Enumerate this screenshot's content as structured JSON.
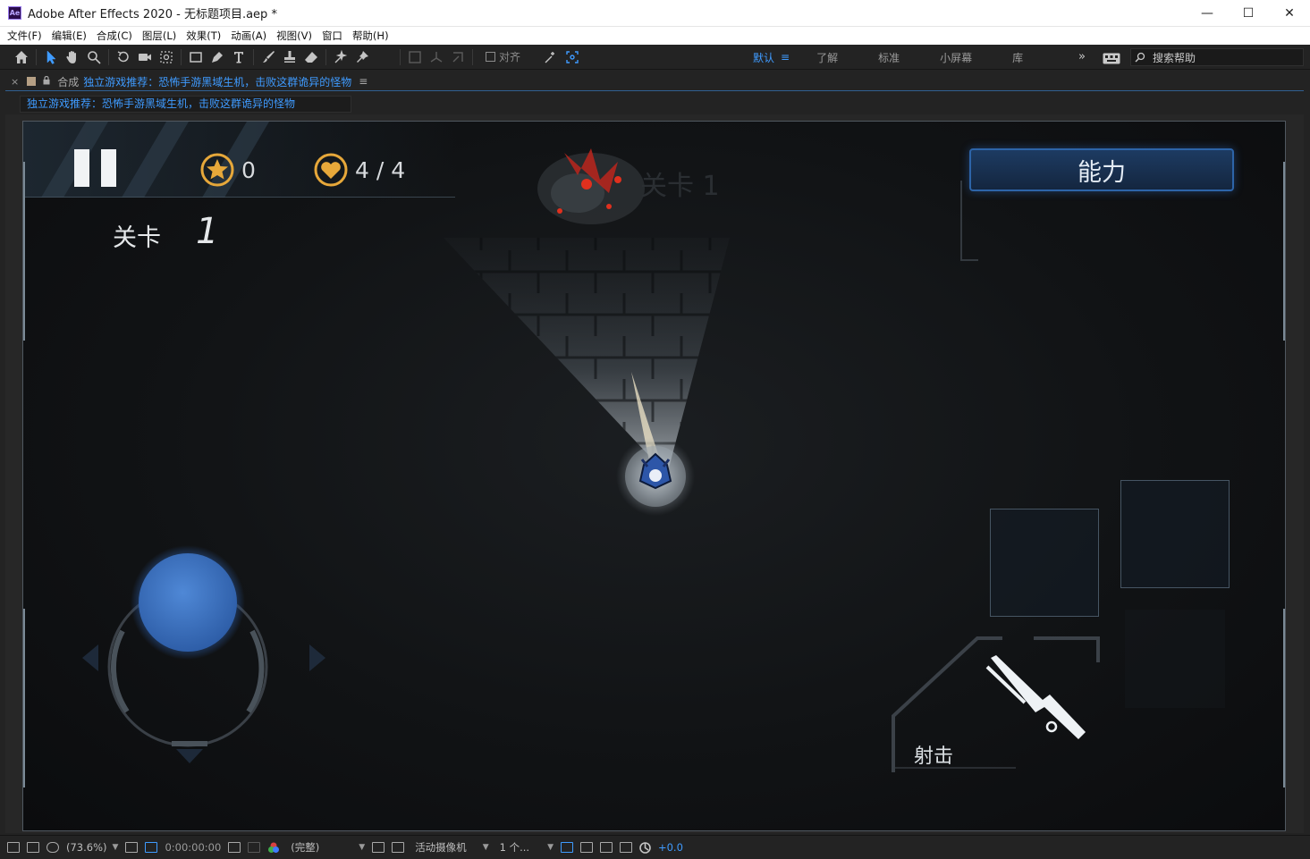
{
  "window": {
    "title": "Adobe After Effects 2020 - 无标题项目.aep *",
    "app_icon_label": "Ae",
    "minimize": "—",
    "maximize": "☐",
    "close": "✕"
  },
  "menu": [
    "文件(F)",
    "编辑(E)",
    "合成(C)",
    "图层(L)",
    "效果(T)",
    "动画(A)",
    "视图(V)",
    "窗口",
    "帮助(H)"
  ],
  "toolbar": {
    "align_label": "对齐",
    "workspaces": [
      "默认",
      "了解",
      "标准",
      "小屏幕",
      "库"
    ],
    "workspace_menu_icon": "≡",
    "overflow": "»",
    "help_search_placeholder": "搜索帮助"
  },
  "panel": {
    "close": "×",
    "kind": "合成",
    "comp_name": "独立游戏推荐：恐怖手游黑域生机，击败这群诡异的怪物",
    "menu_icon": "≡",
    "tab_label": "独立游戏推荐：恐怖手游黑域生机，击败这群诡异的怪物"
  },
  "game": {
    "stars": "0",
    "hp": "4 / 4",
    "level_label": "关卡",
    "level_number": "1",
    "ability_label": "能力",
    "shoot_label": "射击"
  },
  "status": {
    "zoom": "(73.6%)",
    "timecode": "0:00:00:00",
    "resolution": "(完整)",
    "camera": "活动摄像机",
    "views": "1 个...",
    "exposure": "+0.0"
  },
  "colors": {
    "accent": "#3f9bff",
    "panel_bg": "#232323",
    "game_bg": "#0e1012",
    "gold": "#e7a83a",
    "joystick": "#3b6fb8"
  }
}
